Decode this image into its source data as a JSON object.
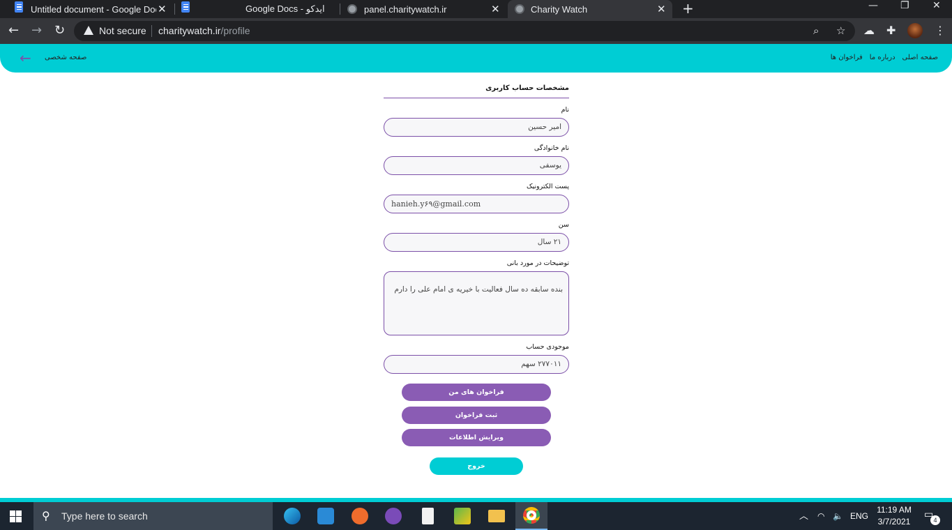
{
  "browser": {
    "tabs": [
      {
        "title": "Untitled document - Google Doc",
        "icon": "google-docs-icon"
      },
      {
        "title": "Google Docs - ایدکو",
        "icon": "google-docs-icon"
      },
      {
        "title": "panel.charitywatch.ir",
        "icon": "globe-icon"
      },
      {
        "title": "Charity Watch",
        "icon": "globe-icon",
        "active": true
      }
    ],
    "close_glyph": "✕",
    "new_tab_glyph": "+",
    "security_label": "Not secure",
    "url_host": "charitywatch.ir",
    "url_path": "/profile"
  },
  "site": {
    "header_title": "صفحه شخصی",
    "nav": [
      "صفحه اصلی",
      "درباره ما",
      "فراخوان ها"
    ],
    "accent_color": "#00cdd4",
    "brand_purple": "#8a5cb4"
  },
  "profile": {
    "section_title": "مشخصات حساب کاربری",
    "first_name_label": "نام",
    "first_name_value": "امیر حسین",
    "last_name_label": "نام خانوادگی",
    "last_name_value": "یوسفی",
    "email_label": "پست الکترونیک",
    "email_value": "hanieh.y۶۹@gmail.com",
    "age_label": "سن",
    "age_value": "۲۱ سال",
    "bio_label": "توضیحات در مورد بانی",
    "bio_value": "بنده سابقه ده سال فعالیت با خیریه ی امام علی را دارم",
    "balance_label": "موجودی حساب",
    "balance_value": "۲۷۷۰۱۱ سهم"
  },
  "actions": {
    "my_calls": "فراخوان های من",
    "submit_call": "ثبت فراخوان",
    "edit_info": "ویرایش اطلاعات",
    "logout": "خروج"
  },
  "taskbar": {
    "search_placeholder": "Type here to search",
    "language": "ENG",
    "time": "11:19 AM",
    "date": "3/7/2021",
    "notification_count": "4"
  }
}
